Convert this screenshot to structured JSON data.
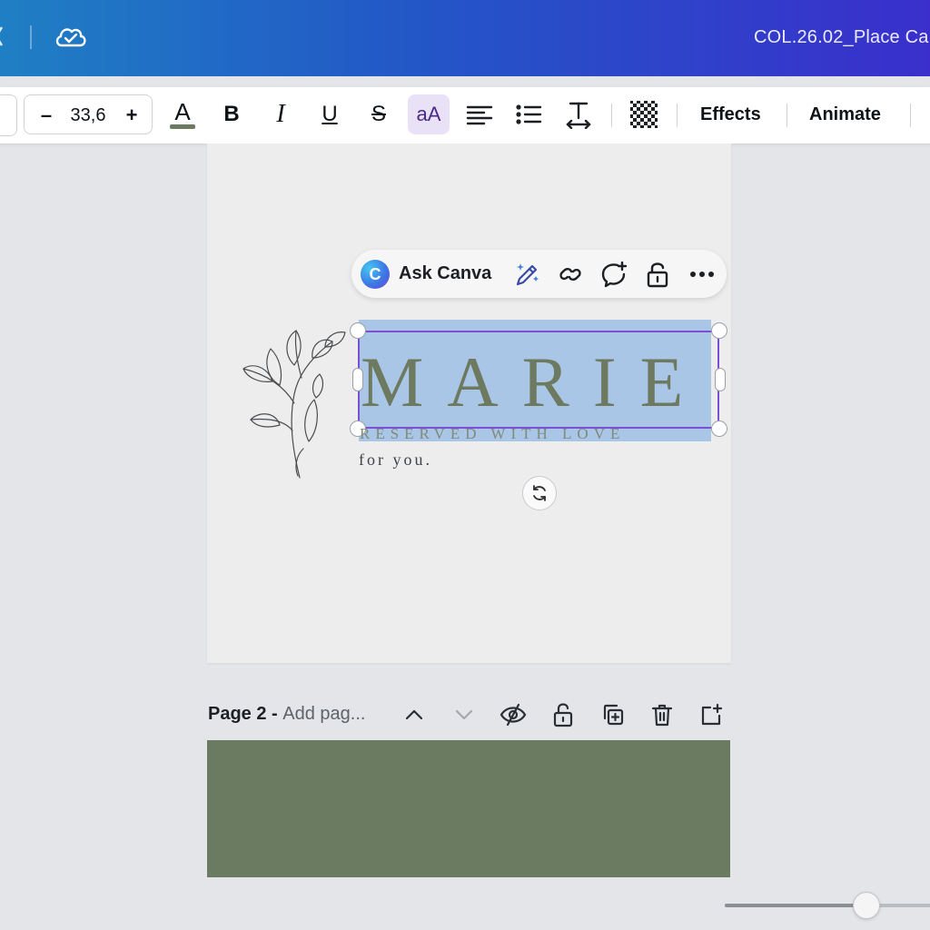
{
  "header": {
    "document_title": "COL.26.02_Place Ca"
  },
  "toolbar": {
    "font_size_minus": "–",
    "font_size_value": "33,6",
    "font_size_plus": "+",
    "text_color_glyph": "A",
    "text_color_underline": "#6d7a60",
    "bold_glyph": "B",
    "italic_glyph": "I",
    "underline_glyph": "U",
    "strike_glyph": "S",
    "case_glyph": "aA",
    "effects_label": "Effects",
    "animate_label": "Animate"
  },
  "ask_bar": {
    "logo_glyph": "C",
    "label": "Ask Canva"
  },
  "page1": {
    "name": "MARIE",
    "reserved": "RESERVED WITH LOVE",
    "for_you": "for you."
  },
  "page2": {
    "label": "Page 2 - ",
    "title_placeholder": "Add pag..."
  },
  "colors": {
    "accent_selection": "#7b4fd6",
    "page2_fill": "#6a7b61",
    "name_text": "#6d7a60"
  },
  "zoom": {
    "level_fraction": 0.65
  }
}
